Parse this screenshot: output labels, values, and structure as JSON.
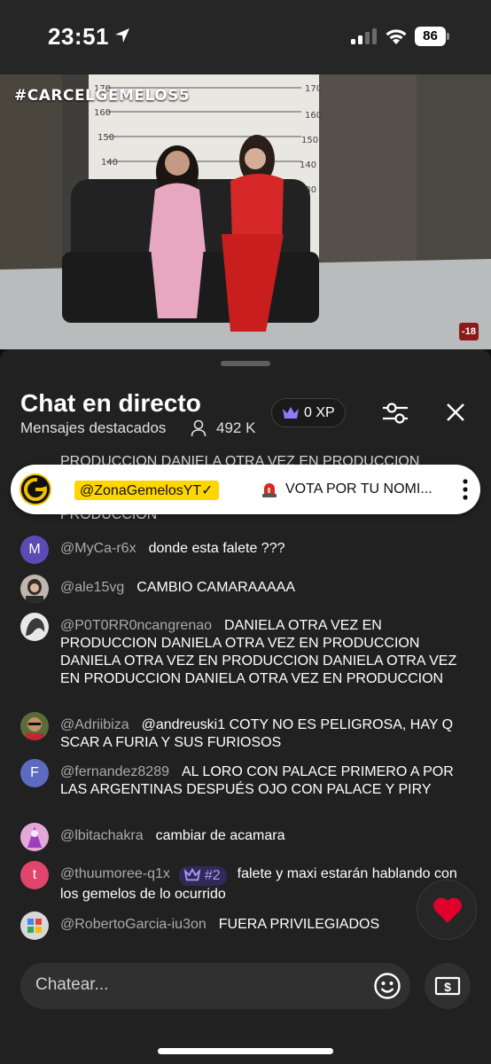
{
  "status_bar": {
    "time": "23:51",
    "battery": "86"
  },
  "video": {
    "hashtag": "#CARCELGEMELOS5",
    "age_rating": "-18"
  },
  "chat_header": {
    "title": "Chat en directo",
    "subtitle": "Mensajes destacados",
    "viewers": "492 K",
    "xp": "0 XP"
  },
  "pinned": {
    "author": "@ZonaGemelosYT✓",
    "text": "VOTA POR TU NOMI..."
  },
  "ghost_lines": {
    "top": "PRODUCCION DANIELA OTRA VEZ EN PRODUCCION",
    "bottom": "PRODUCCION"
  },
  "messages": [
    {
      "author": "@MyCa-r6x",
      "text": "donde esta falete ???",
      "avatar_letter": "M",
      "avatar_color": "#5c4bb5"
    },
    {
      "author": "@ale15vg",
      "text": "CAMBIO CAMARAAAAA"
    },
    {
      "author": "@P0T0RR0ncangrenao",
      "text": "DANIELA OTRA VEZ EN PRODUCCION DANIELA OTRA VEZ EN PRODUCCION DANIELA OTRA VEZ EN PRODUCCION DANIELA OTRA VEZ EN PRODUCCION DANIELA OTRA VEZ EN PRODUCCION"
    },
    {
      "author": "@Adriibiza",
      "text": "@andreuski1 COTY NO ES PELIGROSA, HAY Q SCAR A FURIA Y SUS FURIOSOS"
    },
    {
      "author": "@fernandez8289",
      "text": "AL LORO CON PALACE PRIMERO A POR LAS ARGENTINAS DESPUÉS OJO CON PALACE Y PIRY",
      "avatar_letter": "F",
      "avatar_color": "#5c6bc0"
    },
    {
      "author": "@lbitachakra",
      "text": "cambiar de acamara"
    },
    {
      "author": "@thuumoree-q1x",
      "rank": "#2",
      "text": "falete y maxi estarán hablando con los gemelos de lo ocurrido",
      "avatar_letter": "t",
      "avatar_color": "#e0456b"
    },
    {
      "author": "@RobertoGarcia-iu3on",
      "text": "FUERA PRIVILEGIADOS"
    }
  ],
  "input": {
    "placeholder": "Chatear..."
  },
  "colors": {
    "pinned_author_bg": "#ffd600",
    "rank_badge": "#a99cff",
    "heart": "#e0002a"
  }
}
